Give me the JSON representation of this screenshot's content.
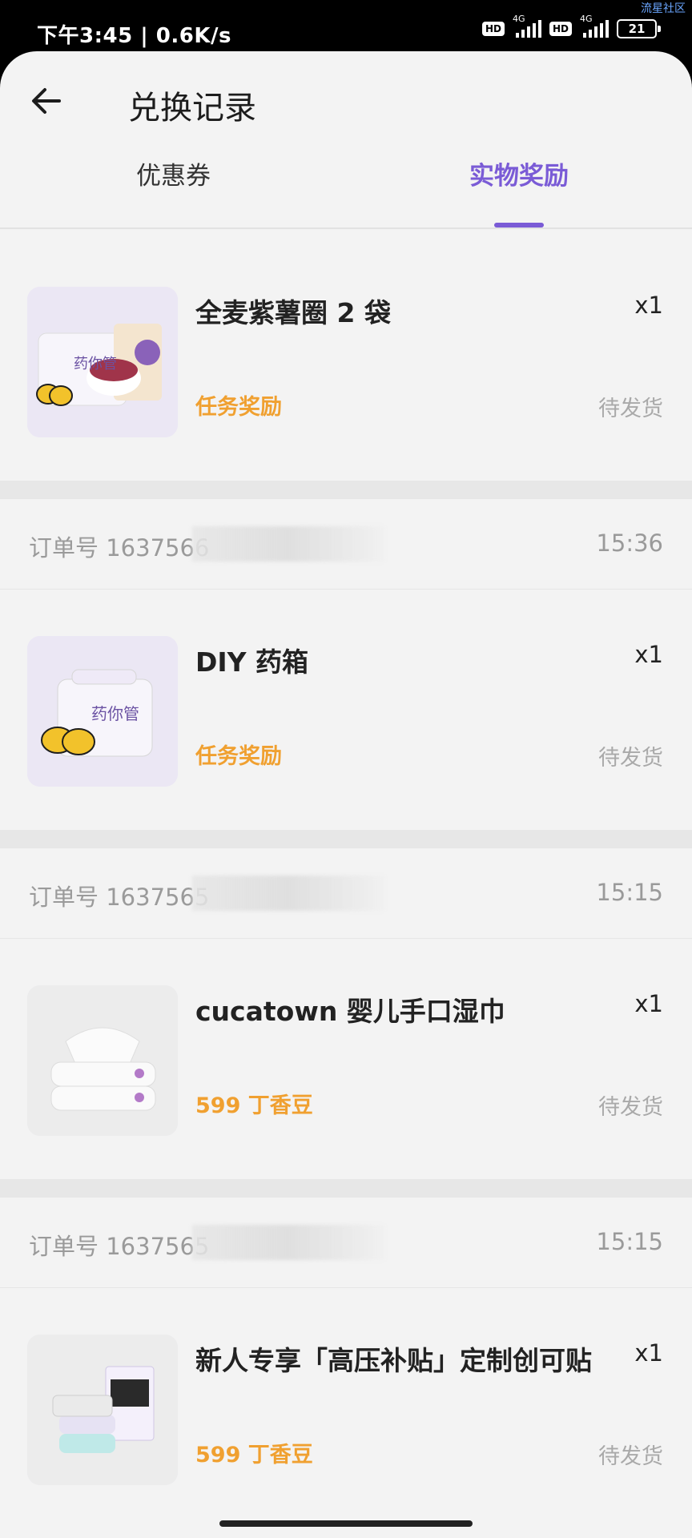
{
  "status_bar": {
    "time_speed": "下午3:45 | 0.6K/s",
    "hd1": "HD",
    "net1": "4G",
    "hd2": "HD",
    "net2": "4G",
    "battery": "21",
    "watermark": "流星社区"
  },
  "header": {
    "title": "兑换记录"
  },
  "tabs": [
    {
      "label": "优惠券",
      "active": false
    },
    {
      "label": "实物奖励",
      "active": true
    }
  ],
  "items": [
    {
      "name": "全麦紫薯圈 2 袋",
      "qty": "x1",
      "reward": "任务奖励",
      "status": "待发货",
      "thumb_icon": "purple-potato-snack-image"
    },
    {
      "order_no": "订单号 1637566",
      "time": "15:36",
      "name": "DIY 药箱",
      "qty": "x1",
      "reward": "任务奖励",
      "status": "待发货",
      "thumb_icon": "medicine-box-image"
    },
    {
      "order_no": "订单号 1637565",
      "time": "15:15",
      "name": "cucatown 婴儿手口湿巾",
      "qty": "x1",
      "reward": "599 丁香豆",
      "status": "待发货",
      "thumb_icon": "baby-wipes-image"
    },
    {
      "order_no": "订单号 1637565",
      "time": "15:15",
      "name": "新人专享「高压补贴」定制创可贴",
      "qty": "x1",
      "reward": "599 丁香豆",
      "status": "待发货",
      "thumb_icon": "bandage-pack-image"
    }
  ],
  "colors": {
    "accent": "#7a5bd6",
    "reward": "#f0a030",
    "status": "#a9a9a9",
    "background": "#f3f3f3"
  }
}
